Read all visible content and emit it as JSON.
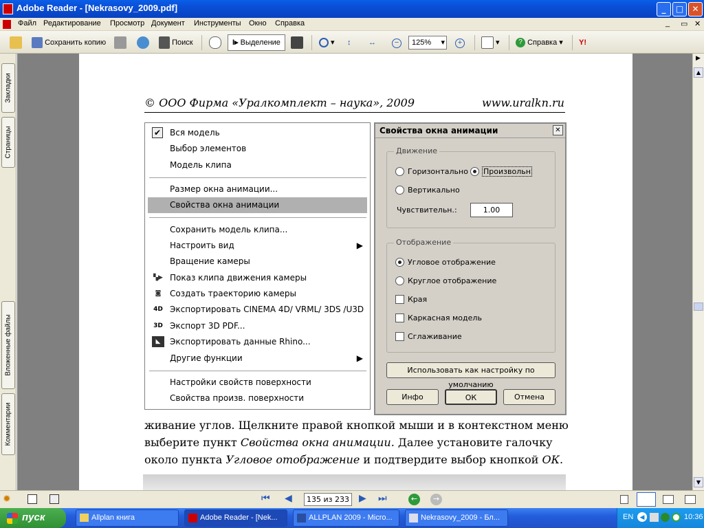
{
  "window": {
    "title": "Adobe Reader - [Nekrasovy_2009.pdf]",
    "min": "_",
    "max": "□",
    "close": "✕"
  },
  "menubar": {
    "items": [
      "Файл",
      "Редактирование",
      "Просмотр",
      "Документ",
      "Инструменты",
      "Окно",
      "Справка"
    ]
  },
  "toolbar": {
    "save_copy": "Сохранить копию",
    "search": "Поиск",
    "select": "Выделение",
    "zoom": "125%",
    "help": "Справка"
  },
  "lefttabs": [
    "Закладки",
    "Страницы",
    "Вложенные файлы",
    "Комментарии"
  ],
  "page": {
    "header_left": "©  ООО Фирма «Уралкомплект – наука», 2009",
    "header_right": "www.uralkn.ru",
    "line1": "живание углов. Щелкните правой кнопкой мыши и в контекстном меню",
    "line2a": "выберите   пункт ",
    "line2b": "Свойства окна анимации.",
    "line2c": " Далее установите галочку",
    "line3a": "около пункта ",
    "line3b": "Угловое отображение",
    "line3c": " и подтвердите выбор кнопкой ",
    "line3d": "ОК",
    "line3e": "."
  },
  "context_menu": {
    "items": [
      {
        "label": "Вся модель",
        "checked": true
      },
      {
        "label": "Выбор элементов"
      },
      {
        "label": "Модель клипа"
      },
      {
        "label": "Размер окна анимации..."
      },
      {
        "label": "Свойства окна анимации",
        "highlighted": true
      },
      {
        "label": "Сохранить модель клипа..."
      },
      {
        "label": "Настроить вид",
        "submenu": true
      },
      {
        "label": "Вращение камеры"
      },
      {
        "label": "Показ клипа движения камеры"
      },
      {
        "label": "Создать траекторию камеры"
      },
      {
        "label": "Экспортировать CINEMA 4D/ VRML/ 3DS /U3D"
      },
      {
        "label": "Экспорт 3D PDF..."
      },
      {
        "label": "Экспортировать данные Rhino..."
      },
      {
        "label": "Другие функции",
        "submenu": true
      },
      {
        "label": "Настройки свойств поверхности"
      },
      {
        "label": "Свойства произв. поверхности"
      }
    ]
  },
  "dialog": {
    "title": "Свойства окна анимации",
    "movement_group": "Движение",
    "horizontal": "Горизонтально",
    "arbitrary": "Произвольн",
    "vertical": "Вертикально",
    "sensitivity_label": "Чувствительн.:",
    "sensitivity_value": "1.00",
    "display_group": "Отображение",
    "angular": "Угловое отображение",
    "round": "Круглое отображение",
    "edges": "Края",
    "wireframe": "Каркасная модель",
    "smoothing": "Сглаживание",
    "default_button": "Использовать как настройку по умолчанию",
    "info_button": "Инфо",
    "ok_button": "ОК",
    "cancel_button": "Отмена"
  },
  "statusbar": {
    "page_indicator": "135 из 233"
  },
  "taskbar": {
    "start": "пуск",
    "tasks": [
      "Allplan книга",
      "Adobe Reader - [Nek...",
      "ALLPLAN 2009 - Micro...",
      "Nekrasovy_2009 - Бл..."
    ],
    "lang": "EN",
    "clock": "10:36"
  }
}
